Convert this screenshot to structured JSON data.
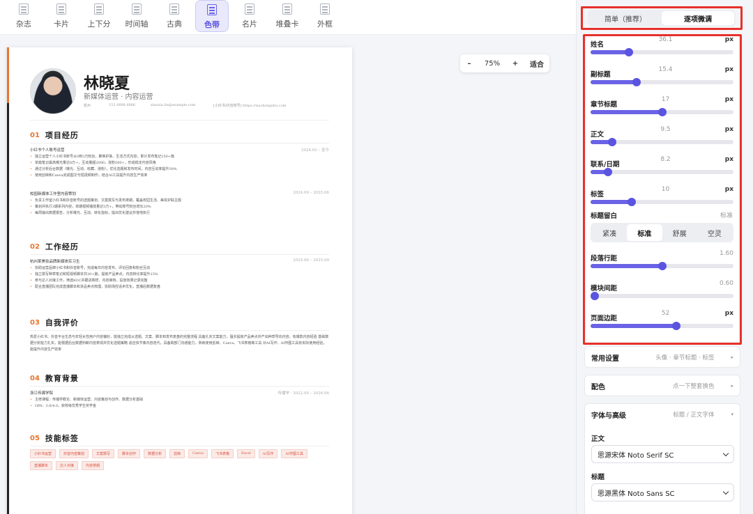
{
  "toolbar": {
    "templates": [
      {
        "label": "杂志",
        "icon": "template-icon"
      },
      {
        "label": "卡片",
        "icon": "template-icon"
      },
      {
        "label": "上下分",
        "icon": "template-icon"
      },
      {
        "label": "时间轴",
        "icon": "template-icon"
      },
      {
        "label": "古典",
        "icon": "template-icon"
      },
      {
        "label": "色带",
        "icon": "template-icon",
        "active": true
      },
      {
        "label": "名片",
        "icon": "template-icon"
      },
      {
        "label": "堆叠卡",
        "icon": "template-icon"
      },
      {
        "label": "外框",
        "icon": "template-icon"
      }
    ]
  },
  "zoom": {
    "minus": "–",
    "value": "75%",
    "plus": "+",
    "fit": "适合"
  },
  "resume": {
    "name": "林晓夏",
    "title": "新媒体运营 · 内容运营",
    "contact": [
      "杭州",
      "153 8888 6666",
      "xiaoxia.lin@example.com",
      "[小红书/抖音账号] https://xiaohongshu.com"
    ],
    "sections": [
      {
        "num": "01",
        "title": "项目经历"
      },
      {
        "num": "02",
        "title": "工作经历"
      },
      {
        "num": "03",
        "title": "自我评价"
      },
      {
        "num": "04",
        "title": "教育背景"
      },
      {
        "num": "05",
        "title": "技能标签"
      }
    ],
    "project1": {
      "name": "小红书个人账号运营",
      "date": "2024.03 – 至今",
      "bullets": [
        "独立运营个人小红书账号从0到3万粉丝，聚焦护肤、生活方式内容，累计发布笔记150+篇",
        "单篇笔记最高曝光量达8万+，互动量超2000，涨粉500+，形成稳定内容风格",
        "通过分析后台数据（曝光、互动、收藏、涨粉），优化选题和发布时间，内容互动率提升30%",
        "使用剪映和Canva完成图文与短视频制作，结合AI工具提升内容生产效率"
      ]
    },
    "project2": {
      "name": "校园新媒体工作室内容策划",
      "date": "2024.09 – 2025.06",
      "bullets": [
        "负责工作室小红书和抖音账号的选题策划、文案撰写与发布排期，覆盖校园生活、美妆护肤主题",
        "策划并执行3期系列内容，单期视频播放量达5万+，带动账号粉丝增长20%",
        "每周输出数据报告，分析曝光、互动、转化指标，提出优化建议并落地执行"
      ]
    },
    "work1": {
      "name": "杭州某美妆品牌新媒体实习生",
      "date": "2025.06 – 2025.09",
      "bullets": [
        "协助运营品牌小红书和抖音账号，完成每日内容发布、评论回复和粉丝互动",
        "独立撰写种草笔记和短视频脚本共30+篇，提炼产品卖点，内容转化率提升15%",
        "参与达人对接工作，筛选KOC并跟进寄样、内容审核，投放效果记录完整",
        "配合直播团队完成直播脚本和货品卖点梳理，协助场控话术优化，直播后数据复盘"
      ]
    },
    "self_eval": "热爱小红书、抖音平台生态与年轻女性用户内容偏好，能独立完成从选题、文案、脚本到发布复盘的完整流程 具备扎实文案能力，擅长提炼产品卖点并产出种草导向内容。有爆款内容经验 基础数据分析能力扎实，能根据后台数据判断内容表现并优化选题策略 适应快节奏内容迭代，具备跨部门沟通能力，熟练使用剪映、Canva、飞书表格等工具 对AI写作、AI作图工具有实际使用经验，能提升内容生产效率",
    "edu": {
      "school": "浙江传媒学院",
      "date": "传播学 · 2022.09 – 2026.06",
      "bullets": [
        "主修课程：传播学概论、新媒体运营、内容策划与创作、数据分析基础",
        "GPA：3.6/4.0，获校级优秀学生奖学金"
      ]
    },
    "tags": [
      "小红书运营",
      "抖音内容策划",
      "文案撰写",
      "脚本创作",
      "数据分析",
      "剪映",
      "Canva",
      "飞书表格",
      "Excel",
      "AI写作",
      "AI作图工具",
      "直播脚本",
      "达人对接",
      "内容排期"
    ]
  },
  "panel": {
    "mode": {
      "simple": "简单（推荐）",
      "fine": "逐项微调"
    },
    "sliders": [
      {
        "label": "姓名",
        "value": "36.1",
        "unit": "px",
        "level": 0.27
      },
      {
        "label": "副标题",
        "value": "15.4",
        "unit": "px",
        "level": 0.32
      },
      {
        "label": "章节标题",
        "value": "17",
        "unit": "px",
        "level": 0.5
      },
      {
        "label": "正文",
        "value": "9.5",
        "unit": "px",
        "level": 0.15
      },
      {
        "label": "联系/日期",
        "value": "8.2",
        "unit": "px",
        "level": 0.12
      },
      {
        "label": "标签",
        "value": "10",
        "unit": "px",
        "level": 0.29
      }
    ],
    "margin_label": "标题留白",
    "margin_value": "标准",
    "margin_options": [
      "紧凑",
      "标准",
      "舒展",
      "空灵"
    ],
    "sliders2": [
      {
        "label": "段落行距",
        "value": "1.60",
        "level": 0.5
      },
      {
        "label": "模块间距",
        "value": "0.60",
        "level": 0.0
      }
    ],
    "page_margin": {
      "label": "页面边距",
      "value": "52",
      "unit": "px",
      "level": 0.6
    },
    "cards": {
      "common": {
        "title": "常用设置",
        "sub": "头像 · 章节标题 · 标签"
      },
      "color": {
        "title": "配色",
        "sub": "点一下整套换色"
      },
      "font": {
        "title": "字体与高级",
        "sub": "标题 / 正文字体"
      }
    },
    "font": {
      "body_label": "正文",
      "body_value": "思源宋体 Noto Serif SC",
      "title_label": "标题",
      "title_value": "思源黑体 Noto Sans SC"
    },
    "accent": "#6a63e6",
    "highlight": "#e8302a"
  }
}
